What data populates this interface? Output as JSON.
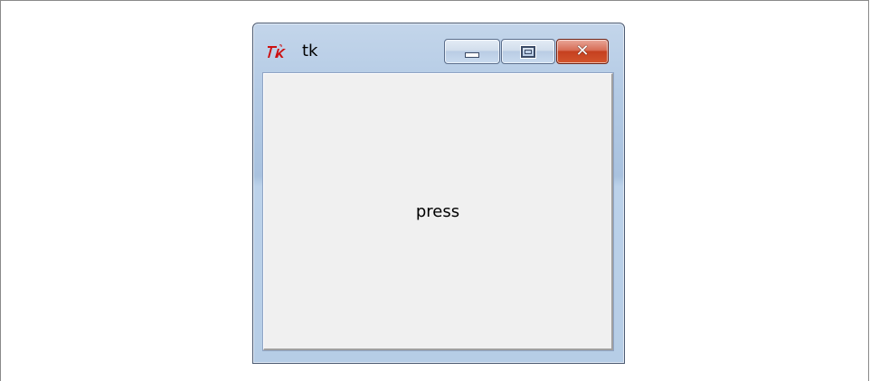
{
  "window": {
    "title": "tk",
    "icon": "tk-feather-logo",
    "controls": {
      "minimize_icon": "minimize-icon",
      "maximize_icon": "maximize-icon",
      "close_icon": "close-icon",
      "close_label": "✕"
    }
  },
  "content": {
    "button_label": "press"
  },
  "colors": {
    "client_bg": "#f0f0f0",
    "titlebar": "#b4cbe5",
    "close_button": "#c5401f"
  }
}
